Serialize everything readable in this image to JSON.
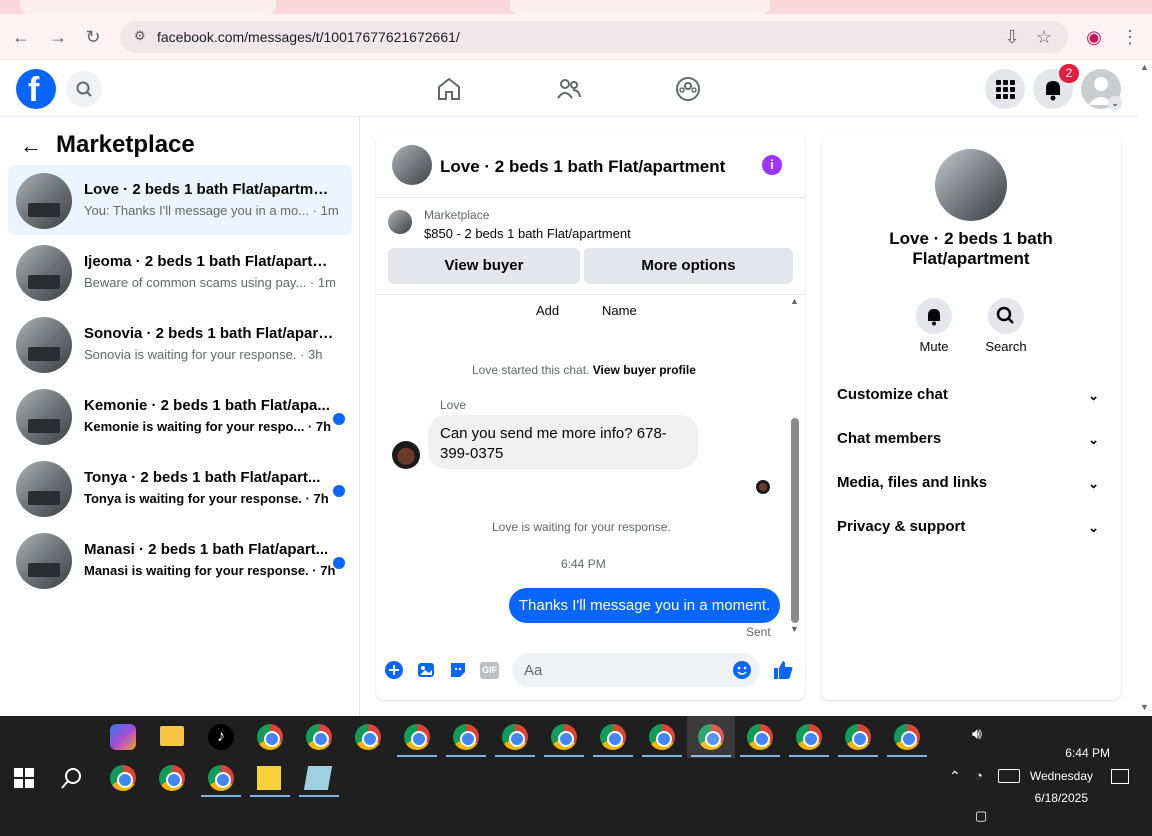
{
  "browser": {
    "url": "facebook.com/messages/t/10017677621672661/"
  },
  "header": {
    "notif_count": "2"
  },
  "left": {
    "title": "Marketplace",
    "conversations": [
      {
        "title": "Love · 2 beds 1 bath Flat/apartment",
        "sub": "You: Thanks I'll message you in a mo... · 1m",
        "unread": false,
        "selected": true
      },
      {
        "title": "Ijeoma · 2 beds 1 bath Flat/apartm...",
        "sub": "Beware of common scams using pay... · 1m",
        "unread": false,
        "selected": false
      },
      {
        "title": "Sonovia · 2 beds 1 bath Flat/apart...",
        "sub": "Sonovia is waiting for your response. · 3h",
        "unread": false,
        "selected": false
      },
      {
        "title": "Kemonie · 2 beds 1 bath Flat/apa...",
        "sub": "Kemonie is waiting for your respo... · 7h",
        "unread": true,
        "selected": false
      },
      {
        "title": "Tonya · 2 beds 1 bath Flat/apart...",
        "sub": "Tonya is waiting for your response. · 7h",
        "unread": true,
        "selected": false
      },
      {
        "title": "Manasi · 2 beds 1 bath Flat/apart...",
        "sub": "Manasi is waiting for your response. · 7h",
        "unread": true,
        "selected": false
      }
    ]
  },
  "chat": {
    "title": "Love · 2 beds 1 bath Flat/apartment",
    "listing_source": "Marketplace",
    "listing": "$850 - 2 beds 1 bath Flat/apartment",
    "view_buyer": "View buyer",
    "more_options": "More options",
    "add": "Add",
    "name": "Name",
    "started": "Love started this chat.",
    "view_profile": "View buyer profile",
    "sender": "Love",
    "incoming": "Can you send me more info? 678-399-0375",
    "waiting": "Love is waiting for your response.",
    "time": "6:44 PM",
    "outgoing": "Thanks I'll message you in a moment.",
    "sent": "Sent",
    "placeholder": "Aa",
    "gif": "GIF"
  },
  "info": {
    "title": "Love · 2 beds 1 bath Flat/apartment",
    "mute": "Mute",
    "search": "Search",
    "sections": [
      "Customize chat",
      "Chat members",
      "Media, files and links",
      "Privacy & support"
    ]
  },
  "taskbar": {
    "time": "6:44 PM",
    "day": "Wednesday",
    "date": "6/18/2025"
  }
}
